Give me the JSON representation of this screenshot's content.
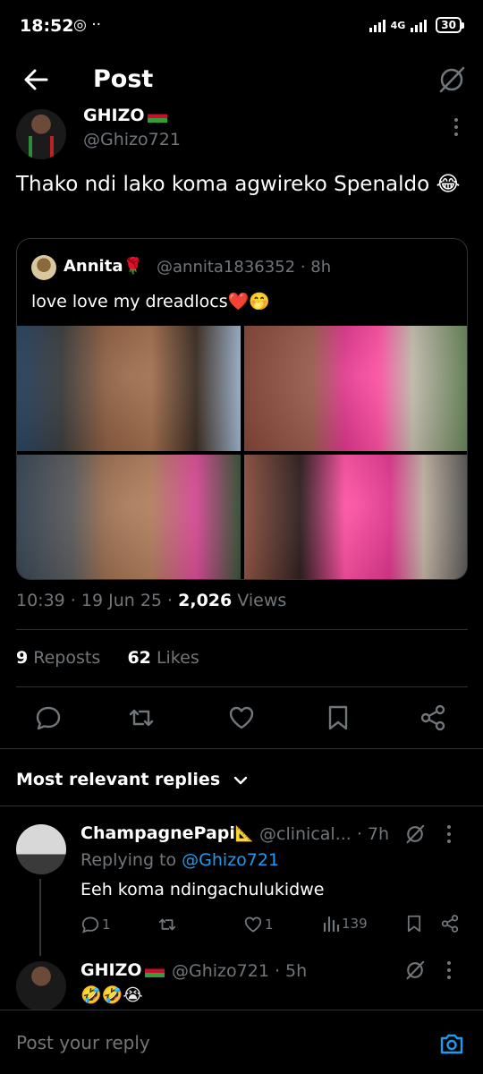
{
  "status_bar": {
    "time": "18:52",
    "left_icons": "◎ ··",
    "network": "4G",
    "battery": "30"
  },
  "header": {
    "title": "Post"
  },
  "post": {
    "author_name": "GHIZO",
    "author_handle": "@Ghizo721",
    "text": "Thako ndi lako koma agwireko Spenaldo 😂",
    "quote": {
      "author_name": "Annita🌹",
      "author_handle": "@annita1836352 · 8h",
      "text": "love love my dreadlocs❤️🤭"
    },
    "time": "10:39 · 19 Jun 25 · ",
    "views_count": "2,026",
    "views_label": " Views",
    "reposts_count": "9",
    "reposts_label": " Reposts",
    "likes_count": "62",
    "likes_label": " Likes"
  },
  "replies_heading": "Most relevant replies",
  "replies": [
    {
      "name": "ChampagnePapi",
      "handle": "@clinical... · 7h",
      "context_prefix": "Replying to ",
      "context_handle": "@Ghizo721",
      "text": "Eeh koma ndingachulukidwe",
      "reply_count": "1",
      "like_count": "1",
      "views": "139"
    },
    {
      "name": "GHIZO",
      "handle": "@Ghizo721 · 5h",
      "text": "🤣🤣😭"
    }
  ],
  "composer": {
    "placeholder": "Post your reply"
  },
  "colors": {
    "accent": "#1d9bf0",
    "muted": "#71767b",
    "border": "#2f3336"
  }
}
